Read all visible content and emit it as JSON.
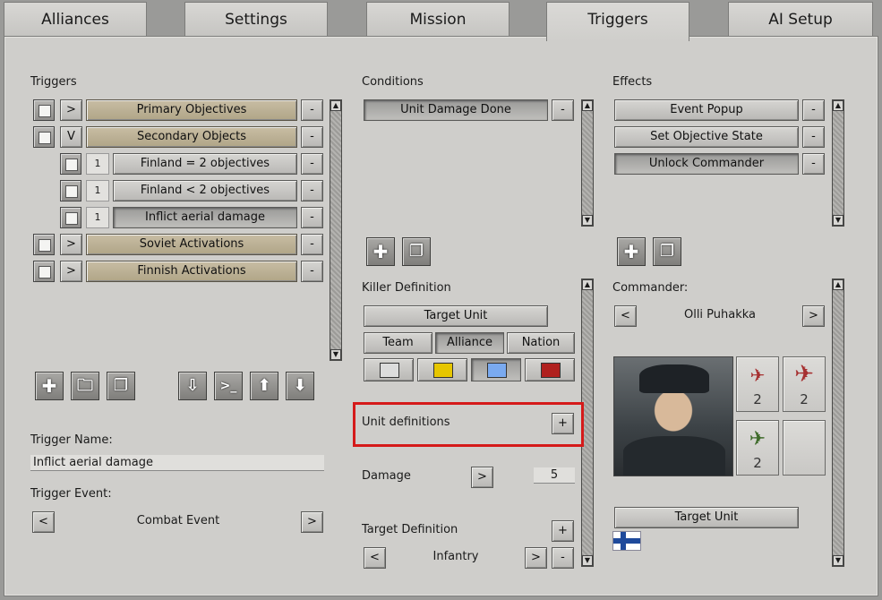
{
  "tabs": [
    "Alliances",
    "Settings",
    "Mission",
    "Triggers",
    "AI Setup"
  ],
  "triggers": {
    "heading": "Triggers",
    "rows": [
      {
        "toggle": ">",
        "label": "Primary Objectives"
      },
      {
        "toggle": "V",
        "label": "Secondary Objects"
      },
      {
        "num": "1",
        "label": "Finland = 2 objectives"
      },
      {
        "num": "1",
        "label": "Finland < 2 objectives"
      },
      {
        "num": "1",
        "label": "Inflict aerial damage"
      },
      {
        "toggle": ">",
        "label": "Soviet Activations"
      },
      {
        "toggle": ">",
        "label": "Finnish Activations"
      }
    ],
    "remove": "-",
    "name_label": "Trigger Name:",
    "name_value": "Inflict aerial damage",
    "event_label": "Trigger Event:",
    "event_value": "Combat Event",
    "prev": "<",
    "next": ">"
  },
  "conditions": {
    "heading": "Conditions",
    "items": [
      "Unit Damage Done"
    ],
    "killer_label": "Killer Definition",
    "target_unit": "Target Unit",
    "modes": [
      "Team",
      "Alliance",
      "Nation"
    ],
    "unit_defs_label": "Unit definitions",
    "plus": "+",
    "damage_label": "Damage",
    "damage_arrow": ">",
    "damage_value": "5",
    "target_def_label": "Target Definition",
    "target_def_value": "Infantry",
    "prev": "<",
    "next": ">",
    "minus": "-"
  },
  "effects": {
    "heading": "Effects",
    "items": [
      "Event Popup",
      "Set Objective State",
      "Unlock Commander"
    ],
    "commander_label": "Commander:",
    "commander_name": "Olli Puhakka",
    "prev": "<",
    "next": ">",
    "planes": [
      "2",
      "2",
      "2"
    ],
    "target_unit": "Target Unit"
  },
  "colors": {
    "swatches": [
      "#dcdcdc",
      "#e6c600",
      "#7aaaf0",
      "#b0201e"
    ],
    "plane_red": "#a63030",
    "plane_green": "#3e6b2a",
    "highlight": "#d51a1a"
  },
  "icons": {
    "plus": "✚",
    "copy": "❐",
    "folder": "🗀",
    "import": "⇩",
    "console": ">_",
    "up": "⬆",
    "down": "⬇",
    "plane": "✈"
  }
}
